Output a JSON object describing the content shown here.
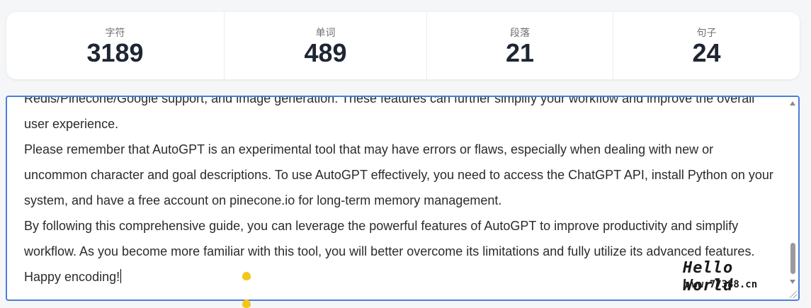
{
  "stats": [
    {
      "label": "字符",
      "value": "3189"
    },
    {
      "label": "单词",
      "value": "489"
    },
    {
      "label": "段落",
      "value": "21"
    },
    {
      "label": "句子",
      "value": "24"
    }
  ],
  "editor": {
    "paragraphs": [
      "Redis/Pinecone/Google support, and image generation. These features can further simplify your workflow and improve the overall user experience.",
      "Please remember that AutoGPT is an experimental tool that may have errors or flaws, especially when dealing with new or uncommon character and goal descriptions. To use AutoGPT effectively, you need to access the ChatGPT API, install Python on your system, and have a free account on pinecone.io for long-term memory management.",
      "By following this comprehensive guide, you can leverage the powerful features of AutoGPT to improve productivity and simplify workflow. As you become more familiar with this tool, you will better overcome its limitations and fully utilize its advanced features. Happy encoding!"
    ]
  },
  "watermark": {
    "title": "Hello World",
    "url": "www.77388.cn"
  },
  "colors": {
    "accent_border": "#4a7fd8",
    "stat_value": "#1e2533",
    "pointer": "#f5c518"
  }
}
